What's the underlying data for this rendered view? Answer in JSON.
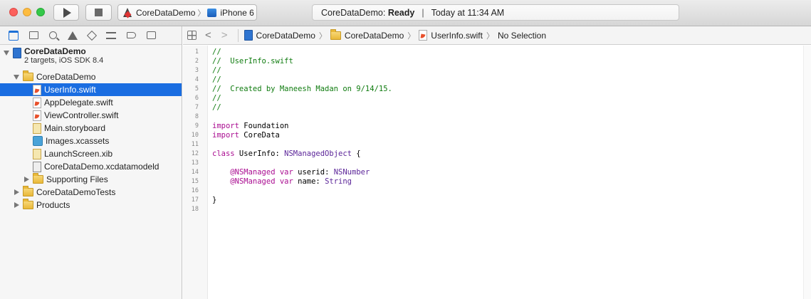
{
  "toolbar": {
    "scheme_name": "CoreDataDemo",
    "device_name": "iPhone 6",
    "status_project": "CoreDataDemo:",
    "status_state": "Ready",
    "status_divider": "|",
    "status_time": "Today at 11:34 AM"
  },
  "navigator": {
    "tabs": [
      "folder-icon",
      "hierarchy-icon",
      "search-icon",
      "warning-icon",
      "test-icon",
      "debug-icon",
      "breakpoint-icon",
      "log-icon"
    ],
    "project": {
      "name": "CoreDataDemo",
      "subtitle": "2 targets, iOS SDK 8.4"
    },
    "items": [
      {
        "label": "CoreDataDemo",
        "kind": "folder",
        "level": 1,
        "disclosure": "open"
      },
      {
        "label": "UserInfo.swift",
        "kind": "swift",
        "level": 2,
        "selected": true
      },
      {
        "label": "AppDelegate.swift",
        "kind": "swift",
        "level": 2
      },
      {
        "label": "ViewController.swift",
        "kind": "swift",
        "level": 2
      },
      {
        "label": "Main.storyboard",
        "kind": "storyboard",
        "level": 2
      },
      {
        "label": "Images.xcassets",
        "kind": "assets",
        "level": 2
      },
      {
        "label": "LaunchScreen.xib",
        "kind": "xib",
        "level": 2
      },
      {
        "label": "CoreDataDemo.xcdatamodeld",
        "kind": "xcdatamodeld",
        "level": 2
      },
      {
        "label": "Supporting Files",
        "kind": "folder",
        "level": 2,
        "disclosure": "closed"
      },
      {
        "label": "CoreDataDemoTests",
        "kind": "folder",
        "level": 1,
        "disclosure": "closed"
      },
      {
        "label": "Products",
        "kind": "folder",
        "level": 1,
        "disclosure": "closed"
      }
    ]
  },
  "jump_bar": {
    "crumbs": [
      "CoreDataDemo",
      "CoreDataDemo",
      "UserInfo.swift",
      "No Selection"
    ]
  },
  "editor": {
    "line_numbers": [
      "1",
      "2",
      "3",
      "4",
      "5",
      "6",
      "7",
      "8",
      "9",
      "10",
      "11",
      "12",
      "13",
      "14",
      "15",
      "16",
      "17",
      "18"
    ],
    "lines": [
      [
        {
          "t": "//",
          "c": "comment"
        }
      ],
      [
        {
          "t": "//  UserInfo.swift",
          "c": "comment"
        }
      ],
      [
        {
          "t": "//",
          "c": "comment"
        }
      ],
      [
        {
          "t": "//",
          "c": "comment"
        }
      ],
      [
        {
          "t": "//  Created by Maneesh Madan on 9/14/15.",
          "c": "comment"
        }
      ],
      [
        {
          "t": "//",
          "c": "comment"
        }
      ],
      [
        {
          "t": "//",
          "c": "comment"
        }
      ],
      [],
      [
        {
          "t": "import",
          "c": "kw"
        },
        {
          "t": " Foundation",
          "c": "plain"
        }
      ],
      [
        {
          "t": "import",
          "c": "kw"
        },
        {
          "t": " CoreData",
          "c": "plain"
        }
      ],
      [],
      [
        {
          "t": "class",
          "c": "kw"
        },
        {
          "t": " UserInfo: ",
          "c": "plain"
        },
        {
          "t": "NSManagedObject",
          "c": "type"
        },
        {
          "t": " {",
          "c": "plain"
        }
      ],
      [],
      [
        {
          "t": "    ",
          "c": "plain"
        },
        {
          "t": "@NSManaged",
          "c": "kw"
        },
        {
          "t": " ",
          "c": "plain"
        },
        {
          "t": "var",
          "c": "kw"
        },
        {
          "t": " userid: ",
          "c": "plain"
        },
        {
          "t": "NSNumber",
          "c": "type"
        }
      ],
      [
        {
          "t": "    ",
          "c": "plain"
        },
        {
          "t": "@NSManaged",
          "c": "kw"
        },
        {
          "t": " ",
          "c": "plain"
        },
        {
          "t": "var",
          "c": "kw"
        },
        {
          "t": " name: ",
          "c": "plain"
        },
        {
          "t": "String",
          "c": "type"
        }
      ],
      [],
      [
        {
          "t": "}",
          "c": "plain"
        }
      ],
      []
    ]
  },
  "colors": {
    "selection": "#1a6de1",
    "comment": "#107c10",
    "keyword": "#aa0d91",
    "type": "#5c2699"
  }
}
